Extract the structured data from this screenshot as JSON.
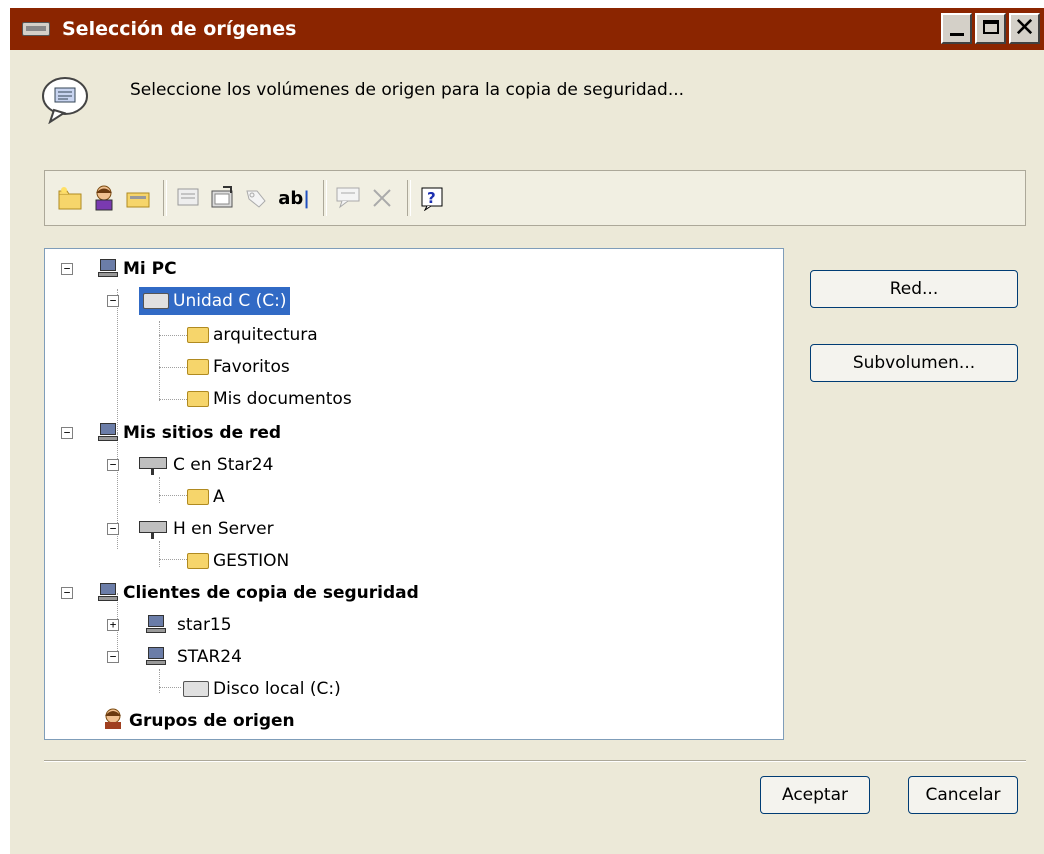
{
  "window": {
    "title": "Selección de orígenes"
  },
  "message": "Seleccione los volúmenes de origen para la copia de seguridad...",
  "tree": {
    "mi_pc": "Mi PC",
    "unidad_c": "Unidad C (C:)",
    "arquitectura": "arquitectura",
    "favoritos": "Favoritos",
    "mis_documentos": "Mis documentos",
    "mis_sitios_red": "Mis sitios de red",
    "c_star24": "C en Star24",
    "a": "A",
    "h_server": "H en Server",
    "gestion": "GESTION",
    "clientes": "Clientes de copia de seguridad",
    "star15": "star15",
    "star24": "STAR24",
    "disco_local": "Disco local (C:)",
    "grupos": "Grupos de origen"
  },
  "buttons": {
    "red": "Red...",
    "subvolumen": "Subvolumen...",
    "aceptar": "Aceptar",
    "cancelar": "Cancelar"
  },
  "toolbar_icons": [
    "new-folder-icon",
    "user-icon",
    "folder-open-icon",
    "properties-icon",
    "settings-icon",
    "tag-icon",
    "rename-icon",
    "comment-icon",
    "delete-icon",
    "help-icon"
  ],
  "colors": {
    "titlebar": "#8b2500",
    "selection": "#316ac5"
  }
}
